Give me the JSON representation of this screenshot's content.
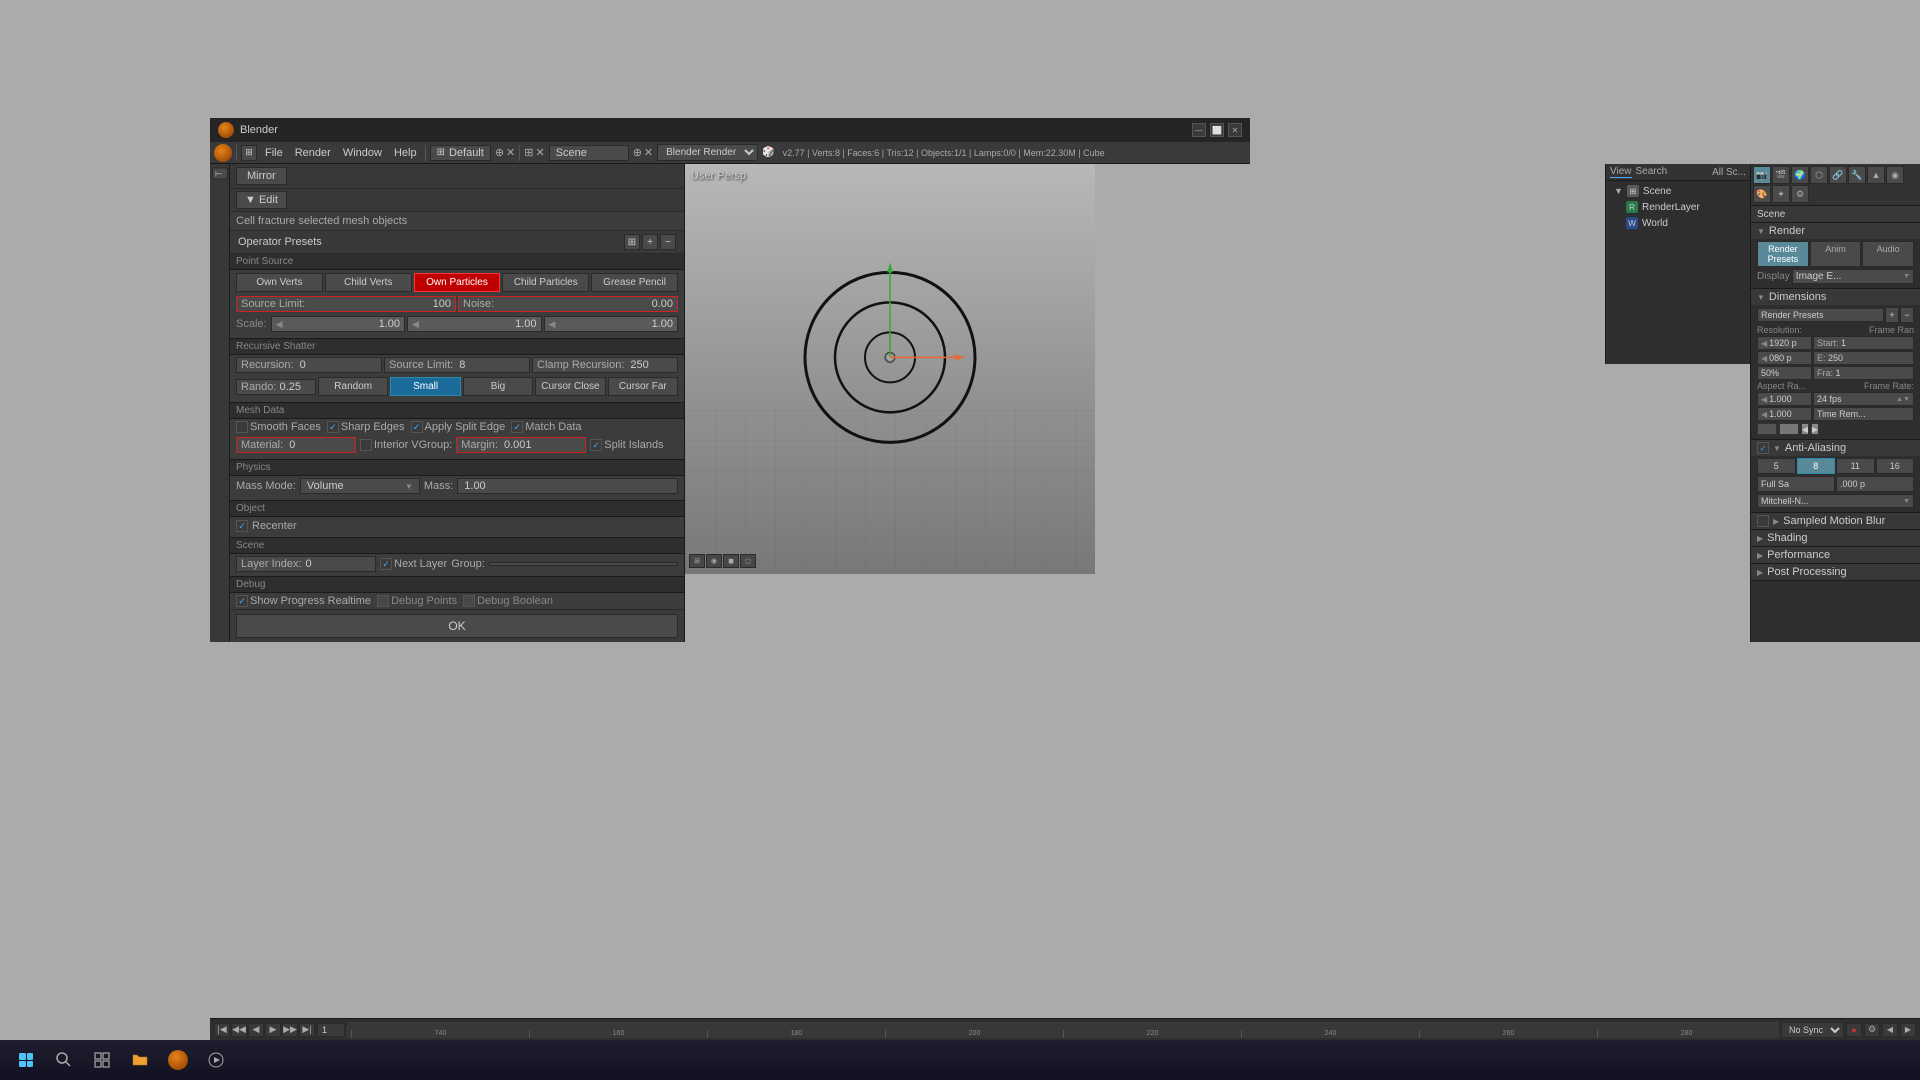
{
  "window": {
    "title": "Blender",
    "logo": "B"
  },
  "menubar": {
    "file": "File",
    "render": "Render",
    "window": "Window",
    "help": "Help",
    "layout": "Default",
    "scene": "Scene",
    "renderer": "Blender Render",
    "info": "v2.77 | Verts:8 | Faces:6 | Tris:12 | Objects:1/1 | Lamps:0/0 | Mem:22.30M | Cube"
  },
  "viewport_label": "User Persp",
  "panel": {
    "edit_btn": "▼ Edit",
    "mirror_btn": "Mirror",
    "cell_fracture_label": "Cell fracture selected mesh objects",
    "operator_presets": "Operator Presets",
    "point_source": {
      "label": "Point Source",
      "buttons": [
        "Own Verts",
        "Child Verts",
        "Own Particles",
        "Child Particles",
        "Grease Pencil"
      ],
      "source_limit_label": "Source Limit:",
      "source_limit_value": "100",
      "noise_label": "Noise:",
      "noise_value": "0.00",
      "scale_label": "Scale:",
      "scale_x": "1.00",
      "scale_y": "1.00",
      "scale_z": "1.00"
    },
    "recursive_shatter": {
      "label": "Recursive Shatter",
      "recursion_label": "Recursion:",
      "recursion_value": "0",
      "source_limit_label": "Source Limit:",
      "source_limit_value": "8",
      "clamp_label": "Clamp Recursion:",
      "clamp_value": "250",
      "rando_label": "Rando:",
      "rando_value": "0.25",
      "buttons": [
        "Random",
        "Small",
        "Big",
        "Cursor Close",
        "Cursor Far"
      ]
    },
    "mesh_data": {
      "label": "Mesh Data",
      "smooth_faces": "Smooth Faces",
      "sharp_edges": "Sharp Edges",
      "apply_split_edge": "Apply Split Edge",
      "match_data": "Match Data",
      "material_label": "Material:",
      "material_value": "0",
      "interior_vgroup": "Interior VGroup:",
      "margin_label": "Margin:",
      "margin_value": "0.001",
      "split_islands": "Split Islands"
    },
    "physics": {
      "label": "Physics",
      "mass_mode_label": "Mass Mode:",
      "mass_mode_value": "Volume",
      "mass_label": "Mass:",
      "mass_value": "1.00"
    },
    "object": {
      "label": "Object",
      "recenter": "Recenter"
    },
    "scene": {
      "label": "Scene",
      "layer_index_label": "Layer Index:",
      "layer_index_value": "0",
      "next_layer": "Next Layer",
      "group_label": "Group:"
    },
    "debug": {
      "label": "Debug",
      "show_progress": "Show Progress Realtime",
      "debug_points": "Debug Points",
      "debug_boolean": "Debug Boolean"
    },
    "ok_btn": "OK"
  },
  "right_panel": {
    "view_label": "View",
    "search_label": "Search",
    "all_scenes_label": "All Sc...",
    "scene_label": "Scene",
    "render_layer_label": "RenderLayer",
    "world_label": "World"
  },
  "properties_panel": {
    "tabs": [
      "render",
      "anim",
      "audio"
    ],
    "scene_label": "Scene",
    "render_section": {
      "label": "Render",
      "presets_label": "Render Presets",
      "display_label": "Display",
      "image_editor_label": "Image E..."
    },
    "dimensions": {
      "label": "Dimensions",
      "render_presets_label": "Render Presets",
      "resolution_label": "Resolution:",
      "res_x": "1920 p",
      "res_y": "080 p",
      "frame_range_label": "Frame Ran",
      "start_label": "Start:",
      "start_value": "1",
      "end_label": "E:",
      "end_value": "250",
      "percent_label": "50%",
      "frame_label": "Fra:",
      "frame_value": "1",
      "aspect_label": "Aspect Ra...",
      "frame_rate_label": "Frame Rate:",
      "aspect_x": "1.000",
      "aspect_y": "1.000",
      "fps_value": "24 fps",
      "time_rem_label": "Time Rem..."
    },
    "anti_aliasing": {
      "label": "Anti-Aliasing",
      "samples_5": "5",
      "samples_8": "8",
      "samples_11": "11",
      "samples_16": "16",
      "full_sample": "Full Sa",
      "value": ".000 p",
      "filter": "Mitchell-N..."
    },
    "shading": {
      "label": "Shading"
    },
    "performance": {
      "label": "Performance"
    },
    "post_processing": {
      "label": "Post Processing"
    }
  },
  "timeline": {
    "frame_start": "1",
    "marks": [
      "740",
      "160",
      "180",
      "200",
      "220",
      "240",
      "260",
      "280"
    ],
    "sync": "No Sync"
  },
  "taskbar": {
    "start_icon": "⊞",
    "search_icon": "🔍",
    "task_view_icon": "⬜",
    "explorer_icon": "📁",
    "blender_icon": "B",
    "media_icon": "▶"
  }
}
